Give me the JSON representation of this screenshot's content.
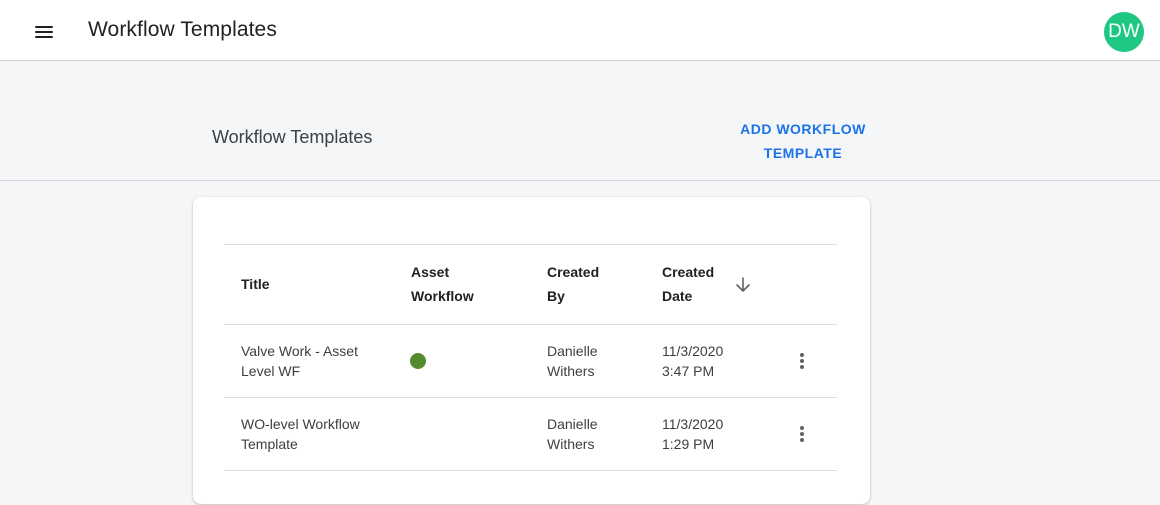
{
  "appbar": {
    "title": "Workflow Templates",
    "menu_icon": "hamburger-menu-icon",
    "avatar_initials": "DW",
    "avatar_color": "#1ec882"
  },
  "page": {
    "title": "Workflow Templates",
    "add_button_line1": "ADD WORKFLOW",
    "add_button_line2": "TEMPLATE",
    "accent_color": "#1a73e8"
  },
  "table": {
    "headers": {
      "title": "Title",
      "asset_workflow_1": "Asset",
      "asset_workflow_2": "Workflow",
      "created_by_1": "Created",
      "created_by_2": "By",
      "created_date_1": "Created",
      "created_date_2": "Date"
    },
    "sort_icon": "arrow-down-icon",
    "rows": [
      {
        "title_1": "Valve Work - Asset",
        "title_2": "Level WF",
        "asset_workflow": true,
        "asset_dot_color": "#558b2f",
        "created_by_1": "Danielle",
        "created_by_2": "Withers",
        "created_date_1": "11/3/2020",
        "created_date_2": "3:47 PM",
        "menu_icon": "more-vertical-icon"
      },
      {
        "title_1": "WO-level Workflow",
        "title_2": "Template",
        "asset_workflow": false,
        "created_by_1": "Danielle",
        "created_by_2": "Withers",
        "created_date_1": "11/3/2020",
        "created_date_2": "1:29 PM",
        "menu_icon": "more-vertical-icon"
      }
    ]
  }
}
